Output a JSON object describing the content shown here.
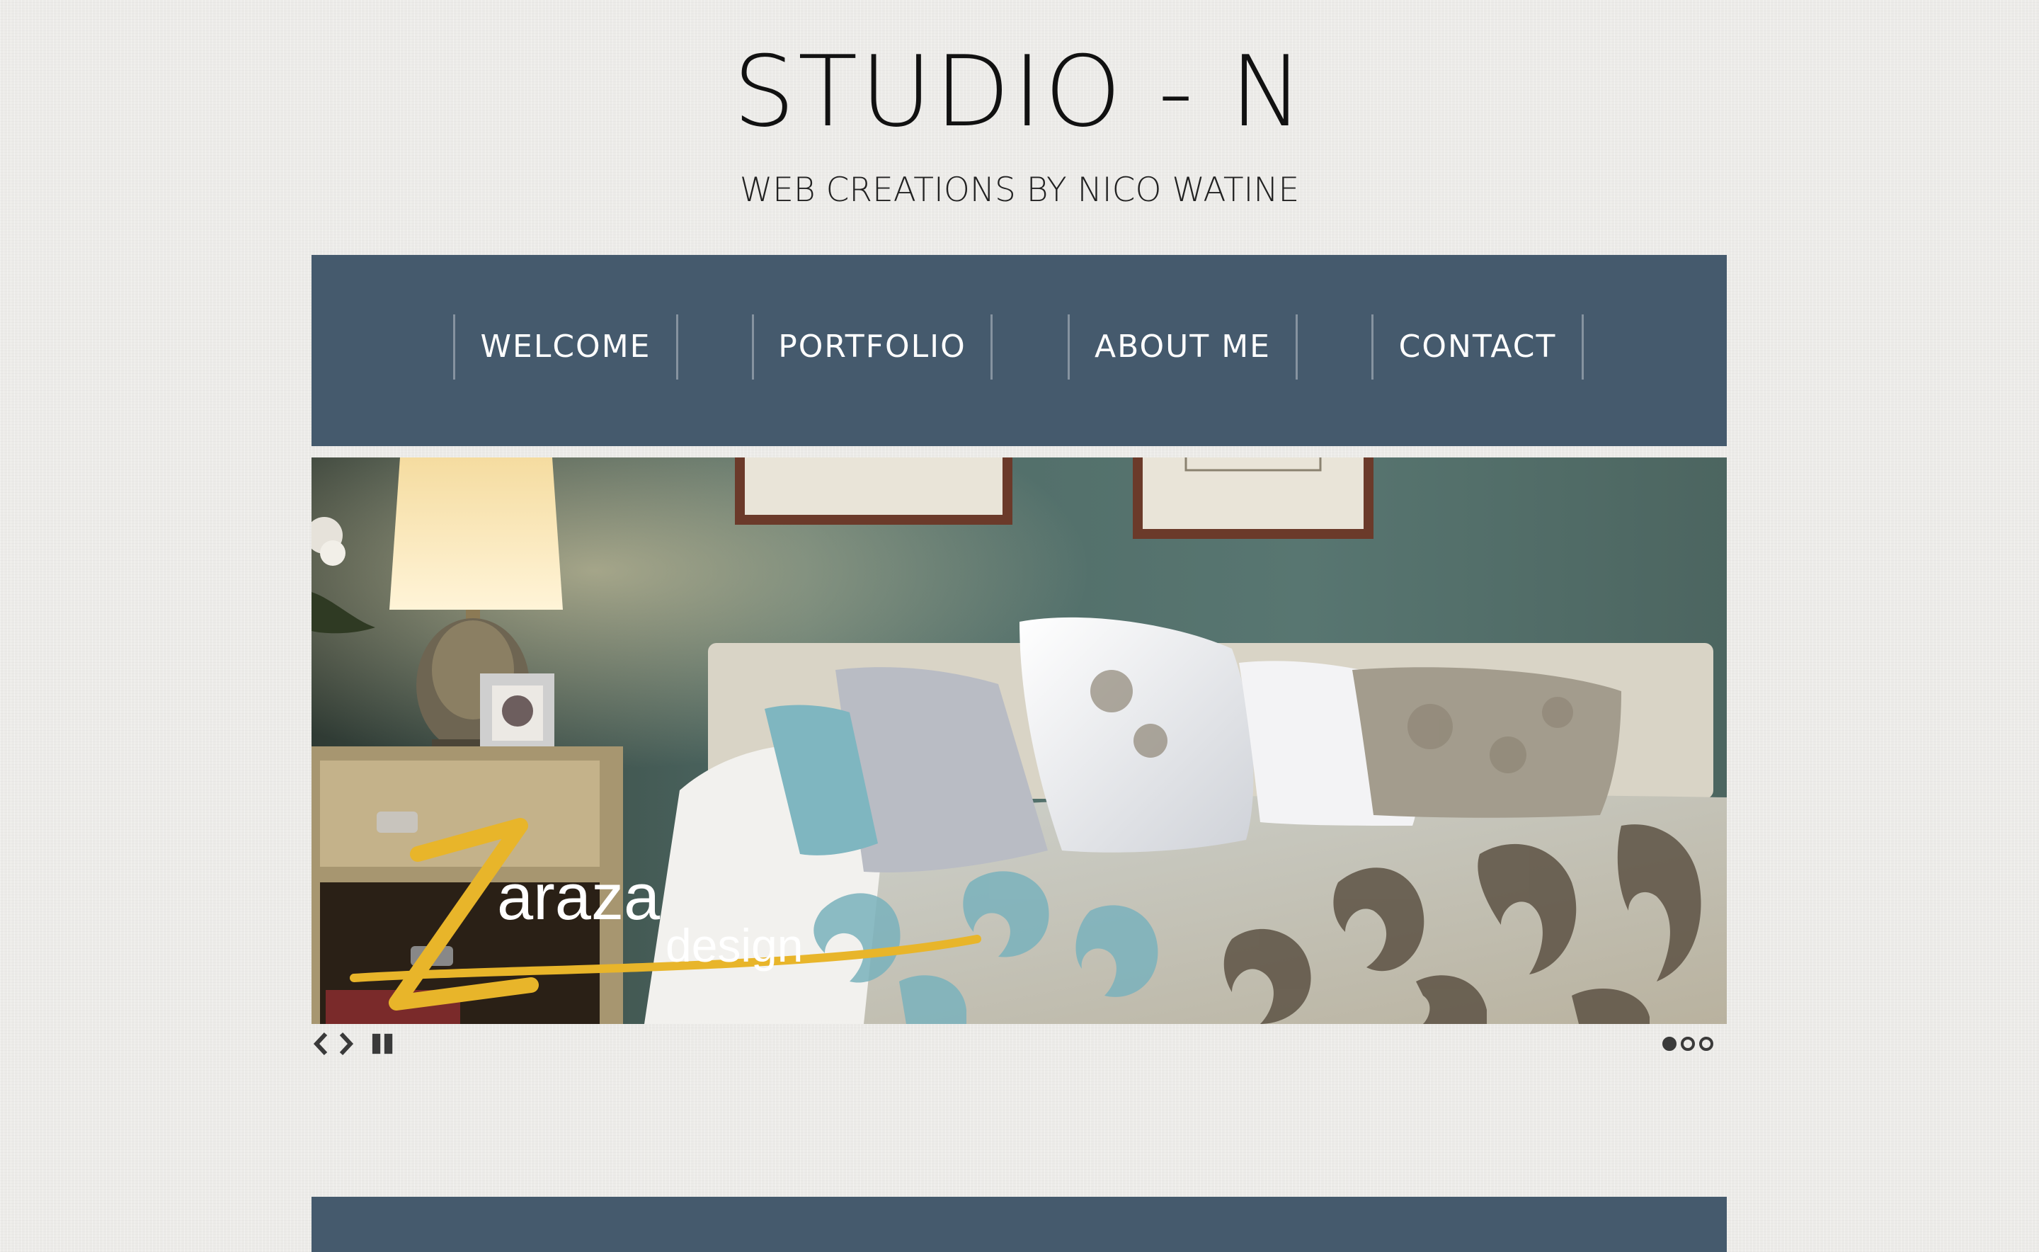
{
  "header": {
    "title": "STUDIO - N",
    "subtitle": "WEB CREATIONS BY NICO WATINE"
  },
  "nav": {
    "items": [
      {
        "label": "WELCOME"
      },
      {
        "label": "PORTFOLIO"
      },
      {
        "label": "ABOUT ME"
      },
      {
        "label": "CONTACT"
      }
    ]
  },
  "slideshow": {
    "logo_text": "araza",
    "logo_subtext": "design",
    "logo_letter": "Z",
    "slide_count": 3,
    "active_slide": 1,
    "controls": [
      "prev-icon",
      "next-icon",
      "pause-icon"
    ]
  },
  "colors": {
    "background": "#ecebe8",
    "nav_bar": "#455a6d",
    "nav_text": "#ffffff",
    "title_text": "#111111",
    "logo_yellow": "#e8b52a"
  }
}
